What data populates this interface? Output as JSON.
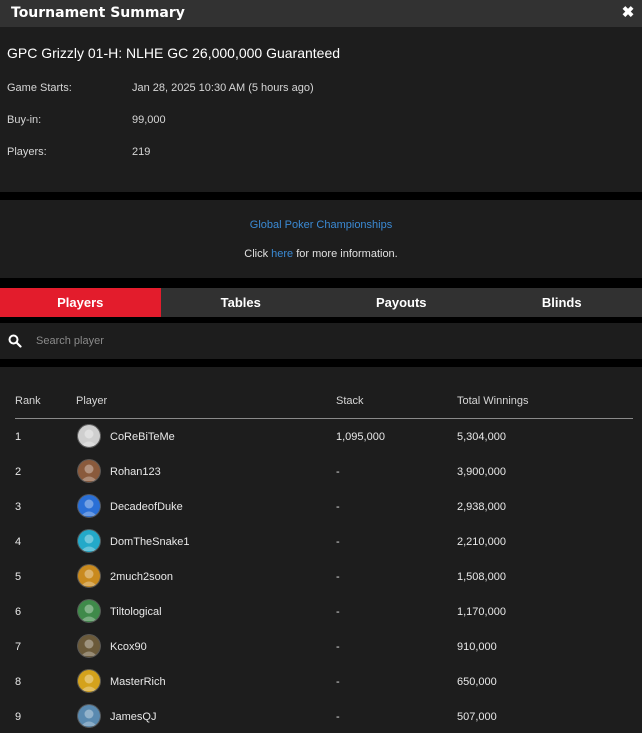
{
  "window": {
    "title": "Tournament Summary"
  },
  "tournament": {
    "name": "GPC Grizzly 01-H: NLHE GC 26,000,000 Guaranteed",
    "fields": [
      {
        "label": "Game Starts:",
        "value": "Jan 28, 2025 10:30 AM (5 hours ago)"
      },
      {
        "label": "Buy-in:",
        "value": "99,000"
      },
      {
        "label": "Players:",
        "value": "219"
      }
    ]
  },
  "banner": {
    "link_text": "Global Poker Championships",
    "info_prefix": "Click",
    "info_link": "here",
    "info_suffix": "for more information."
  },
  "tabs": [
    "Players",
    "Tables",
    "Payouts",
    "Blinds"
  ],
  "active_tab": 0,
  "search": {
    "placeholder": "Search player"
  },
  "players_table": {
    "headers": [
      "Rank",
      "Player",
      "Stack",
      "Total Winnings"
    ],
    "rows": [
      {
        "rank": "1",
        "player": "CoReBiTeMe",
        "stack": "1,095,000",
        "winnings": "5,304,000",
        "avatar_color": "#cfcfcf"
      },
      {
        "rank": "2",
        "player": "Rohan123",
        "stack": "-",
        "winnings": "3,900,000",
        "avatar_color": "#8a5a3c"
      },
      {
        "rank": "3",
        "player": "DecadeofDuke",
        "stack": "-",
        "winnings": "2,938,000",
        "avatar_color": "#2a6fd6"
      },
      {
        "rank": "4",
        "player": "DomTheSnake1",
        "stack": "-",
        "winnings": "2,210,000",
        "avatar_color": "#23a9c9"
      },
      {
        "rank": "5",
        "player": "2much2soon",
        "stack": "-",
        "winnings": "1,508,000",
        "avatar_color": "#c98a1e"
      },
      {
        "rank": "6",
        "player": "Tiltological",
        "stack": "-",
        "winnings": "1,170,000",
        "avatar_color": "#3f8a4a"
      },
      {
        "rank": "7",
        "player": "Kcox90",
        "stack": "-",
        "winnings": "910,000",
        "avatar_color": "#6b5a3a"
      },
      {
        "rank": "8",
        "player": "MasterRich",
        "stack": "-",
        "winnings": "650,000",
        "avatar_color": "#d4a21c"
      },
      {
        "rank": "9",
        "player": "JamesQJ",
        "stack": "-",
        "winnings": "507,000",
        "avatar_color": "#5a8ab0"
      }
    ]
  }
}
